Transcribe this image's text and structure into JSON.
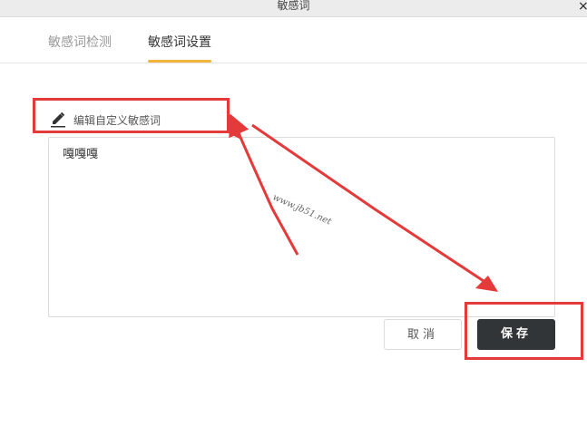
{
  "window": {
    "title": "敏感词",
    "close_glyph": "×"
  },
  "tabs": [
    {
      "label": "敏感词检测",
      "active": false
    },
    {
      "label": "敏感词设置",
      "active": true
    }
  ],
  "accent_color": "#f3b43b",
  "annotation_color": "#e53a3a",
  "editor": {
    "label": "编辑自定义敏感词",
    "icon": "pencil-icon",
    "value": "嘎嘎嘎"
  },
  "buttons": {
    "cancel": "取消",
    "save": "保存"
  },
  "watermark": "www.jb51.net"
}
